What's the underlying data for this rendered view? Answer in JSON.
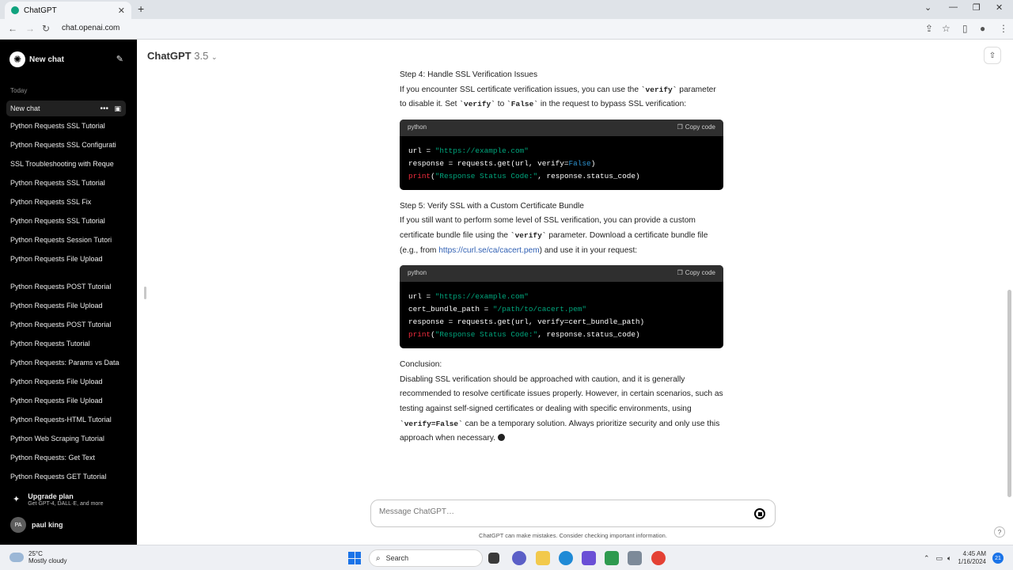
{
  "browser": {
    "tab_title": "ChatGPT",
    "url": "chat.openai.com"
  },
  "sidebar": {
    "new_chat": "New chat",
    "section_today": "Today",
    "active_item": "New chat",
    "items": [
      "Python Requests SSL Tutorial",
      "Python Requests SSL Configurati",
      "SSL Troubleshooting with Reque",
      "Python Requests SSL Tutorial",
      "Python Requests SSL Fix",
      "Python Requests SSL Tutorial",
      "Python Requests Session Tutori",
      "Python Requests File Upload",
      "Python Requests POST Tutorial",
      "Python Requests File Upload",
      "Python Requests POST Tutorial",
      "Python Requests Tutorial",
      "Python Requests: Params vs Data",
      "Python Requests File Upload",
      "Python Requests File Upload",
      "Python Requests-HTML Tutorial",
      "Python Web Scraping Tutorial",
      "Python Requests: Get Text",
      "Python Requests GET Tutorial"
    ],
    "upgrade_title": "Upgrade plan",
    "upgrade_sub": "Get GPT-4, DALL·E, and more",
    "avatar_initials": "PA",
    "username": "paul king"
  },
  "header": {
    "model": "ChatGPT",
    "version": "3.5"
  },
  "content": {
    "step4_title": "Step 4: Handle SSL Verification Issues",
    "step4_p1": "If you encounter SSL certificate verification issues, you can use the ",
    "step4_code1": "`verify`",
    "step4_p2": " parameter to disable it. Set ",
    "step4_code2": "`verify`",
    "step4_p3": " to ",
    "step4_code3": "`False`",
    "step4_p4": " in the request to bypass SSL verification:",
    "code1_lang": "python",
    "copy_label": "Copy code",
    "step5_title": "Step 5: Verify SSL with a Custom Certificate Bundle",
    "step5_p1": "If you still want to perform some level of SSL verification, you can provide a custom certificate bundle file using the ",
    "step5_code1": "`verify`",
    "step5_p2": " parameter. Download a certificate bundle file (e.g., from ",
    "step5_link": "https://curl.se/ca/cacert.pem",
    "step5_p3": ") and use it in your request:",
    "code2_lang": "python",
    "conclusion_title": "Conclusion:",
    "conclusion_p1": "Disabling SSL verification should be approached with caution, and it is generally recommended to resolve certificate issues properly. However, in certain scenarios, such as testing against self-signed certificates or dealing with specific environments, using ",
    "conclusion_code": "`verify=False`",
    "conclusion_p2": " can be a temporary solution. Always prioritize security and only use this approach when necessary."
  },
  "code1": {
    "l1_a": "url = ",
    "l1_s": "\"https://example.com\"",
    "l2_a": "response = requests.get(url, verify=",
    "l2_k": "False",
    "l2_b": ")",
    "l3_f": "print",
    "l3_a": "(",
    "l3_s": "\"Response Status Code:\"",
    "l3_b": ", response.status_code)"
  },
  "code2": {
    "l1_a": "url = ",
    "l1_s": "\"https://example.com\"",
    "l2_a": "cert_bundle_path = ",
    "l2_s": "\"/path/to/cacert.pem\"",
    "l3_a": "response = requests.get(url, verify=cert_bundle_path)",
    "l4_f": "print",
    "l4_a": "(",
    "l4_s": "\"Response Status Code:\"",
    "l4_b": ", response.status_code)"
  },
  "composer": {
    "placeholder": "Message ChatGPT…",
    "disclaimer": "ChatGPT can make mistakes. Consider checking important information."
  },
  "taskbar": {
    "temp": "25°C",
    "weather": "Mostly cloudy",
    "search": "Search",
    "time": "4:45 AM",
    "date": "1/16/2024",
    "notif_count": "21"
  }
}
